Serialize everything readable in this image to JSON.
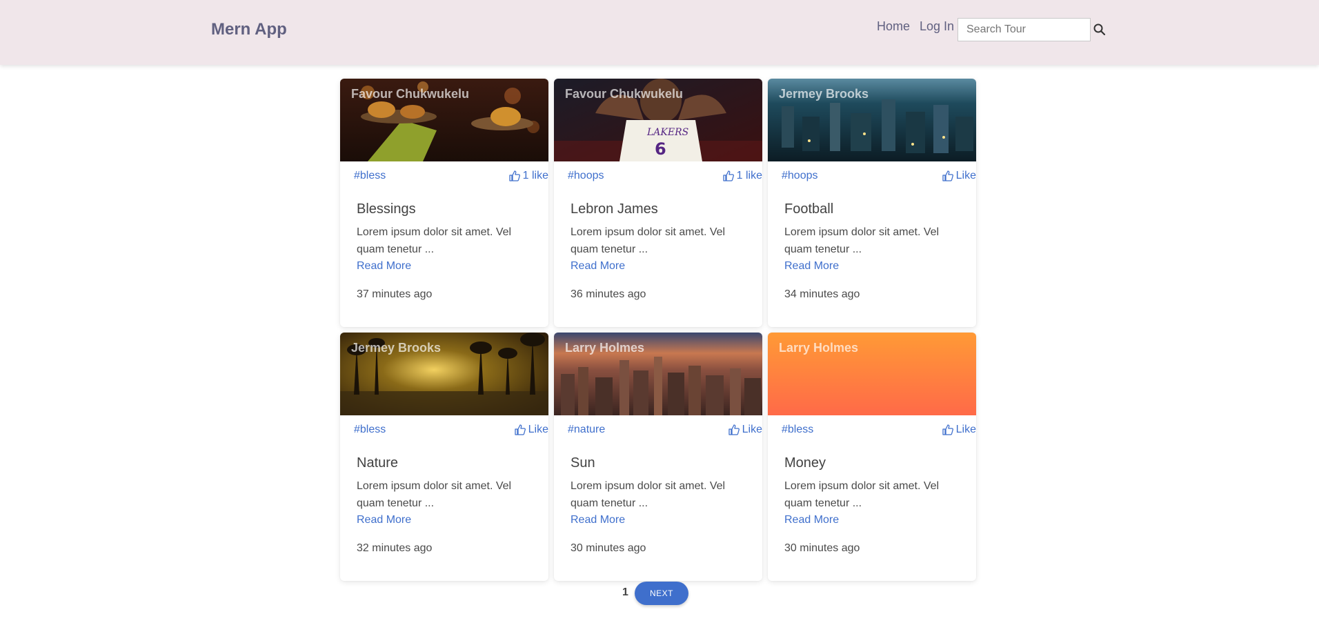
{
  "navbar": {
    "brand": "Mern App",
    "links": [
      "Home",
      "Log In"
    ],
    "search": {
      "placeholder": "Search Tour",
      "value": ""
    }
  },
  "tours": [
    {
      "author": "Favour Chukwukelu",
      "tag": "#bless",
      "like": "1 like",
      "title": "Blessings",
      "description": "Lorem ipsum dolor sit amet. Vel quam tenetur ...",
      "read_more": "Read More",
      "time": "37 minutes ago",
      "image": "burgers-restaurant"
    },
    {
      "author": "Favour Chukwukelu",
      "tag": "#hoops",
      "like": "1 like",
      "title": "Lebron James",
      "description": "Lorem ipsum dolor sit amet. Vel quam tenetur ...",
      "read_more": "Read More",
      "time": "36 minutes ago",
      "image": "lakers-player"
    },
    {
      "author": "Jermey Brooks",
      "tag": "#hoops",
      "like": "Like",
      "title": "Football",
      "description": "Lorem ipsum dolor sit amet. Vel quam tenetur ...",
      "read_more": "Read More",
      "time": "34 minutes ago",
      "image": "city-aerial-night"
    },
    {
      "author": "Jermey Brooks",
      "tag": "#bless",
      "like": "Like",
      "title": "Nature",
      "description": "Lorem ipsum dolor sit amet. Vel quam tenetur ...",
      "read_more": "Read More",
      "time": "32 minutes ago",
      "image": "forest-sunset"
    },
    {
      "author": "Larry Holmes",
      "tag": "#nature",
      "like": "Like",
      "title": "Sun",
      "description": "Lorem ipsum dolor sit amet. Vel quam tenetur ...",
      "read_more": "Read More",
      "time": "30 minutes ago",
      "image": "city-skyline-sunset"
    },
    {
      "author": "Larry Holmes",
      "tag": "#bless",
      "like": "Like",
      "title": "Money",
      "description": "Lorem ipsum dolor sit amet. Vel quam tenetur ...",
      "read_more": "Read More",
      "time": "30 minutes ago",
      "image": "orange-gradient"
    }
  ],
  "pagination": {
    "current_page": "1",
    "next_label": "NEXT"
  },
  "colors": {
    "navbar_bg": "#f0e6ea",
    "brand": "#606080",
    "accent": "#3f6fcc"
  },
  "icons": {
    "search": "search-icon",
    "like": "thumbs-up-icon"
  }
}
